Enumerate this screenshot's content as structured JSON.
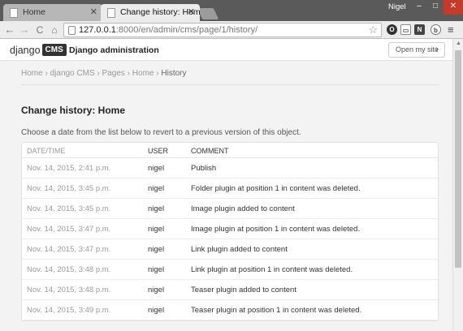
{
  "browser": {
    "tabs": [
      {
        "title": "Home",
        "active": false
      },
      {
        "title": "Change history: Home | D",
        "active": true
      }
    ],
    "profile_name": "Nigel",
    "window_controls": {
      "minimize": "–",
      "maximize": "□",
      "close": "✕"
    },
    "url": {
      "host": "127.0.0.1",
      "path": ":8000/en/admin/cms/page/1/history/"
    },
    "nav_icons": {
      "back": "←",
      "forward": "→",
      "reload": "C",
      "home": "⌂",
      "star": "☆",
      "menu": "≡"
    },
    "extensions": [
      "O",
      "▭",
      "N",
      "b"
    ]
  },
  "header": {
    "logo_text": "django",
    "logo_badge": "CMS",
    "site_title": "Django administration",
    "open_site_label": "Open my site"
  },
  "breadcrumbs": [
    "Home",
    "django CMS",
    "Pages",
    "Home",
    "History"
  ],
  "breadcrumb_separator": "›",
  "page_title": "Change history: Home",
  "intro": "Choose a date from the list below to revert to a previous version of this object.",
  "table": {
    "columns": [
      "Date/time",
      "User",
      "Comment"
    ],
    "rows": [
      {
        "date": "Nov. 14, 2015, 2:41 p.m.",
        "user": "nigel",
        "comment": "Publish"
      },
      {
        "date": "Nov. 14, 2015, 3:45 p.m.",
        "user": "nigel",
        "comment": "Folder plugin at position 1 in content was deleted."
      },
      {
        "date": "Nov. 14, 2015, 3:45 p.m.",
        "user": "nigel",
        "comment": "Image plugin added to content"
      },
      {
        "date": "Nov. 14, 2015, 3:47 p.m.",
        "user": "nigel",
        "comment": "Image plugin at position 1 in content was deleted."
      },
      {
        "date": "Nov. 14, 2015, 3:47 p.m.",
        "user": "nigel",
        "comment": "Link plugin added to content"
      },
      {
        "date": "Nov. 14, 2015, 3:48 p.m.",
        "user": "nigel",
        "comment": "Link plugin at position 1 in content was deleted."
      },
      {
        "date": "Nov. 14, 2015, 3:48 p.m.",
        "user": "nigel",
        "comment": "Teaser plugin added to content"
      },
      {
        "date": "Nov. 14, 2015, 3:49 p.m.",
        "user": "nigel",
        "comment": "Teaser plugin at position 1 in content was deleted."
      }
    ]
  },
  "colors": {
    "accent": "#333333",
    "page_bg": "#f3f3f3",
    "close_red": "#c7392b"
  }
}
